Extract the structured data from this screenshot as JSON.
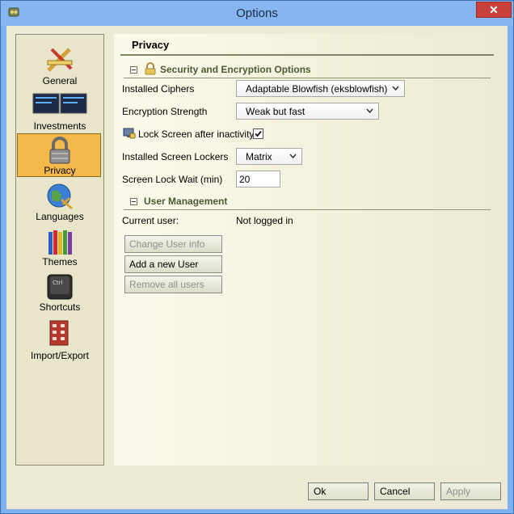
{
  "window": {
    "title": "Options",
    "close_label": "✕"
  },
  "sidebar": {
    "items": [
      {
        "label": "General",
        "icon": "tools-icon",
        "selected": false
      },
      {
        "label": "Investments",
        "icon": "monitors-icon",
        "selected": false
      },
      {
        "label": "Privacy",
        "icon": "padlock-icon",
        "selected": true
      },
      {
        "label": "Languages",
        "icon": "globe-icon",
        "selected": false
      },
      {
        "label": "Themes",
        "icon": "crayons-icon",
        "selected": false
      },
      {
        "label": "Shortcuts",
        "icon": "ctrl-key-icon",
        "selected": false
      },
      {
        "label": "Import/Export",
        "icon": "building-icon",
        "selected": false
      }
    ]
  },
  "main": {
    "title": "Privacy",
    "security_section": {
      "title": "Security and Encryption Options",
      "installed_ciphers_label": "Installed Ciphers",
      "installed_ciphers_value": "Adaptable Blowfish (eksblowfish)",
      "encryption_strength_label": "Encryption Strength",
      "encryption_strength_value": "Weak but fast",
      "lock_screen_label": "Lock Screen after inactivity",
      "lock_screen_checked": true,
      "screen_lockers_label": "Installed Screen Lockers",
      "screen_lockers_value": "Matrix",
      "lock_wait_label": "Screen Lock Wait (min)",
      "lock_wait_value": "20"
    },
    "user_section": {
      "title": "User Management",
      "current_user_label": "Current user:",
      "current_user_value": "Not logged in",
      "change_user_label": "Change User info",
      "add_user_label": "Add a new User",
      "remove_users_label": "Remove all users"
    }
  },
  "footer": {
    "ok_label": "Ok",
    "cancel_label": "Cancel",
    "apply_label": "Apply"
  },
  "colors": {
    "titlebar": "#86b5f0",
    "selected_item": "#f4b94a",
    "section_text": "#4b5a34",
    "close_button": "#c7413a"
  }
}
